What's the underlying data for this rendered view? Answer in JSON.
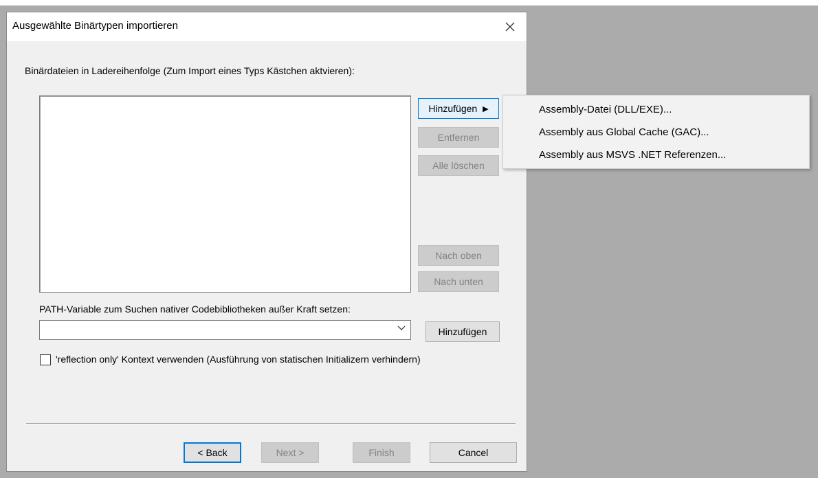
{
  "dialog": {
    "title": "Ausgewählte Binärtypen importieren",
    "close_icon": "close-icon",
    "binaries_label": "Binärdateien in Ladereihenfolge (Zum Import eines Typs Kästchen aktvieren):",
    "side_buttons": {
      "add": "Hinzufügen",
      "remove": "Entfernen",
      "clear_all": "Alle löschen",
      "move_up": "Nach oben",
      "move_down": "Nach unten"
    },
    "path_label": "PATH-Variable zum Suchen nativer Codebibliotheken außer Kraft setzen:",
    "path_combo_value": "",
    "path_add_button": "Hinzufügen",
    "reflection_checkbox_label": "'reflection only' Kontext verwenden (Ausführung von statischen Initializern verhindern)",
    "reflection_checked": false,
    "footer": {
      "back": "< Back",
      "next": "Next >",
      "finish": "Finish",
      "cancel": "Cancel"
    }
  },
  "add_menu": {
    "items": [
      "Assembly-Datei (DLL/EXE)...",
      "Assembly aus Global Cache (GAC)...",
      "Assembly aus MSVS .NET Referenzen..."
    ]
  },
  "colors": {
    "backdrop": "#ababab",
    "dialog_bg": "#f0f0f0",
    "focus_accent": "#0078d7"
  }
}
